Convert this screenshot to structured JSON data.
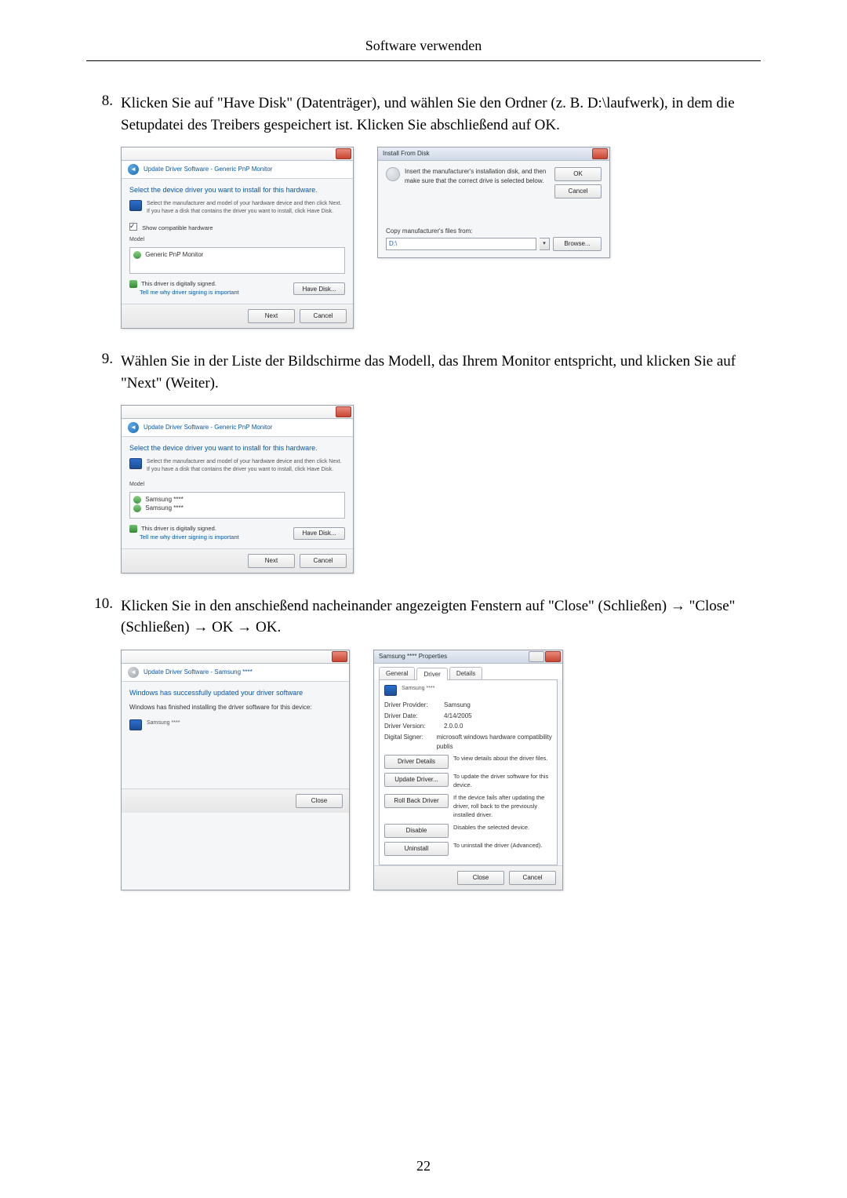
{
  "header": {
    "title": "Software verwenden"
  },
  "page_number": "22",
  "steps": {
    "s8": {
      "num": "8.",
      "text": "Klicken Sie auf \"Have Disk\" (Datenträger), und wählen Sie den Ordner (z. B. D:\\laufwerk), in dem die Setupdatei des Treibers gespeichert ist. Klicken Sie abschließend auf OK."
    },
    "s9": {
      "num": "9.",
      "text": "Wählen Sie in der Liste der Bildschirme das Modell, das Ihrem Monitor entspricht, und klicken Sie auf \"Next\" (Weiter)."
    },
    "s10": {
      "num": "10.",
      "text": "Klicken Sie in den anschießend nacheinander angezeigten Fenstern auf \"Close\" (Schließen) → \"Close\" (Schließen) → OK → OK."
    }
  },
  "dlg_update_a": {
    "breadcrumb": "Update Driver Software - Generic PnP Monitor",
    "heading": "Select the device driver you want to install for this hardware.",
    "desc": "Select the manufacturer and model of your hardware device and then click Next. If you have a disk that contains the driver you want to install, click Have Disk.",
    "show_compat": "Show compatible hardware",
    "list_label": "Model",
    "list_item": "Generic PnP Monitor",
    "signed": "This driver is digitally signed.",
    "signed_link": "Tell me why driver signing is important",
    "have_disk_btn": "Have Disk...",
    "next_btn": "Next",
    "cancel_btn": "Cancel"
  },
  "dlg_install_disk": {
    "title": "Install From Disk",
    "desc": "Insert the manufacturer's installation disk, and then make sure that the correct drive is selected below.",
    "ok_btn": "OK",
    "cancel_btn": "Cancel",
    "copy_label": "Copy manufacturer's files from:",
    "path": "D:\\",
    "browse_btn": "Browse..."
  },
  "dlg_update_b": {
    "breadcrumb": "Update Driver Software - Generic PnP Monitor",
    "heading": "Select the device driver you want to install for this hardware.",
    "desc": "Select the manufacturer and model of your hardware device and then click Next. If you have a disk that contains the driver you want to install, click Have Disk.",
    "list_label": "Model",
    "list_item1": "Samsung ****",
    "list_item2": "Samsung ****",
    "signed": "This driver is digitally signed.",
    "signed_link": "Tell me why driver signing is important",
    "have_disk_btn": "Have Disk...",
    "next_btn": "Next",
    "cancel_btn": "Cancel"
  },
  "dlg_update_done": {
    "breadcrumb": "Update Driver Software - Samsung ****",
    "heading": "Windows has successfully updated your driver software",
    "desc": "Windows has finished installing the driver software for this device:",
    "device": "Samsung ****",
    "close_btn": "Close"
  },
  "dlg_props": {
    "title": "Samsung **** Properties",
    "tabs": {
      "general": "General",
      "driver": "Driver",
      "details": "Details"
    },
    "device": "Samsung ****",
    "provider_k": "Driver Provider:",
    "provider_v": "Samsung",
    "date_k": "Driver Date:",
    "date_v": "4/14/2005",
    "version_k": "Driver Version:",
    "version_v": "2.0.0.0",
    "signer_k": "Digital Signer:",
    "signer_v": "microsoft windows hardware compatibility publis",
    "btn_details": "Driver Details",
    "note_details": "To view details about the driver files.",
    "btn_update": "Update Driver...",
    "note_update": "To update the driver software for this device.",
    "btn_rollback": "Roll Back Driver",
    "note_rollback": "If the device fails after updating the driver, roll back to the previously installed driver.",
    "btn_disable": "Disable",
    "note_disable": "Disables the selected device.",
    "btn_uninstall": "Uninstall",
    "note_uninstall": "To uninstall the driver (Advanced).",
    "close_btn": "Close",
    "cancel_btn": "Cancel"
  }
}
